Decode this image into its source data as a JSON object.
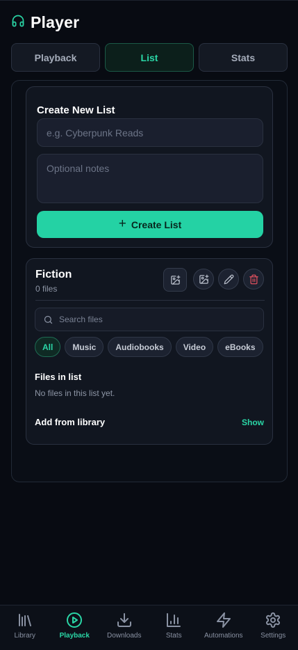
{
  "app": {
    "title": "Player"
  },
  "tabs": [
    {
      "label": "Playback",
      "active": false
    },
    {
      "label": "List",
      "active": true
    },
    {
      "label": "Stats",
      "active": false
    }
  ],
  "create_list": {
    "heading": "Create New List",
    "name_placeholder": "e.g. Cyberpunk Reads",
    "notes_placeholder": "Optional notes",
    "button_label": "Create List",
    "button_icon": "plus-icon"
  },
  "list": {
    "name": "Fiction",
    "count": "0 files",
    "actions": [
      "add-image-icon",
      "change-cover-icon",
      "edit-icon",
      "delete-icon"
    ],
    "search_placeholder": "Search files",
    "filters": [
      "All",
      "Music",
      "Audiobooks",
      "Video",
      "eBooks"
    ],
    "active_filter": "All",
    "files_heading": "Files in list",
    "empty_text": "No files in this list yet.",
    "add_heading": "Add from library",
    "show_label": "Show"
  },
  "nav": [
    {
      "label": "Library",
      "icon": "library-icon",
      "active": false
    },
    {
      "label": "Playback",
      "icon": "play-circle-icon",
      "active": true
    },
    {
      "label": "Downloads",
      "icon": "download-icon",
      "active": false
    },
    {
      "label": "Stats",
      "icon": "bar-chart-icon",
      "active": false
    },
    {
      "label": "Automations",
      "icon": "lightning-icon",
      "active": false
    },
    {
      "label": "Settings",
      "icon": "gear-icon",
      "active": false
    }
  ],
  "colors": {
    "accent": "#24d2a4",
    "background": "#080b12",
    "danger": "#e0505e"
  }
}
